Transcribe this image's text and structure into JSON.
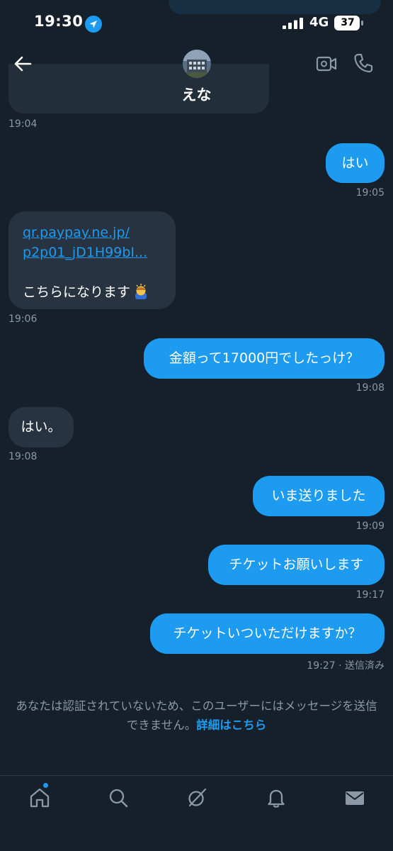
{
  "status_bar": {
    "time": "19:30",
    "network": "4G",
    "battery": "37"
  },
  "header": {
    "contact_name": "えな"
  },
  "messages": [
    {
      "direction": "in",
      "time": "19:04"
    },
    {
      "direction": "out",
      "text": "はい",
      "time": "19:05"
    },
    {
      "direction": "in",
      "link_line1": "qr.paypay.ne.jp/",
      "link_line2": "p2p01_jD1H99bI...",
      "text": "こちらになります",
      "emoji": "bowing-person-emoji",
      "time": "19:06"
    },
    {
      "direction": "out",
      "text": "金額って17000円でしたっけ？",
      "time": "19:08"
    },
    {
      "direction": "in",
      "text": "はい。",
      "time": "19:08"
    },
    {
      "direction": "out",
      "text": "いま送りました",
      "time": "19:09"
    },
    {
      "direction": "out",
      "text": "チケットお願いします",
      "time": "19:17"
    },
    {
      "direction": "out",
      "text": "チケットいついただけますか？",
      "time": "19:27 · 送信済み"
    }
  ],
  "notice": {
    "text": "あなたは認証されていないため、このユーザーにはメッセージを送信できません。",
    "link": "詳細はこちら"
  },
  "nav": {
    "items": [
      "home-icon",
      "search-icon",
      "grok-icon",
      "bell-icon",
      "mail-icon"
    ]
  },
  "colors": {
    "background": "#15202b",
    "incoming_bubble": "#273340",
    "outgoing_bubble": "#1d9bf0",
    "muted_text": "#8b98a5"
  }
}
